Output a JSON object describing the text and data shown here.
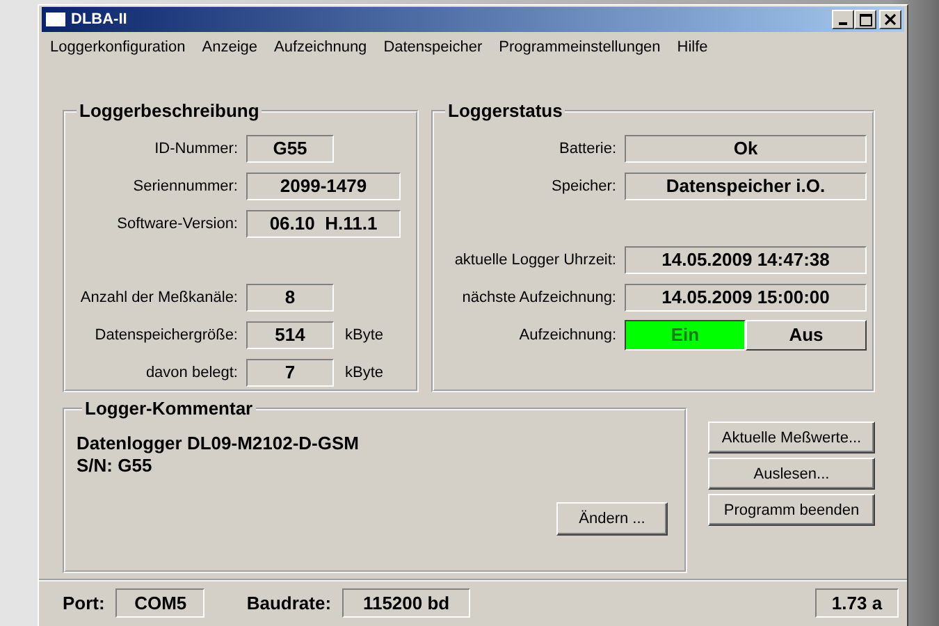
{
  "window": {
    "title": "DLBA-II"
  },
  "menu": [
    "Loggerkonfiguration",
    "Anzeige",
    "Aufzeichnung",
    "Datenspeicher",
    "Programmeinstellungen",
    "Hilfe"
  ],
  "description": {
    "title": "Loggerbeschreibung",
    "groups": [
      [
        {
          "label": "ID-Nummer:",
          "value": "G55",
          "kind": "short"
        },
        {
          "label": "Seriennummer:",
          "value": "2099-1479",
          "kind": "wide"
        },
        {
          "label": "Software-Version:",
          "value": "06.10  H.11.1",
          "kind": "wide"
        }
      ],
      [
        {
          "label": "Anzahl der Meßkanäle:",
          "value": "8",
          "kind": "short"
        },
        {
          "label": "Datenspeichergröße:",
          "value": "514",
          "kind": "short",
          "unit": "kByte"
        },
        {
          "label": "davon belegt:",
          "value": "7",
          "kind": "short",
          "unit": "kByte"
        }
      ]
    ]
  },
  "status": {
    "title": "Loggerstatus",
    "groups": [
      [
        {
          "label": "Batterie:",
          "value": "Ok"
        },
        {
          "label": "Speicher:",
          "value": "Datenspeicher i.O."
        }
      ],
      [
        {
          "label": "aktuelle Logger Uhrzeit:",
          "value": "14.05.2009 14:47:38"
        },
        {
          "label": "nächste Aufzeichnung:",
          "value": "14.05.2009 15:00:00"
        }
      ]
    ],
    "recording": {
      "label": "Aufzeichnung:",
      "options": [
        {
          "label": "Ein",
          "selected": true
        },
        {
          "label": "Aus",
          "selected": false
        }
      ]
    }
  },
  "comment": {
    "title": "Logger-Kommentar",
    "lines": [
      "Datenlogger DL09-M2102-D-GSM",
      "S/N: G55"
    ],
    "button": "Ändern ..."
  },
  "buttons": [
    "Aktuelle Meßwerte...",
    "Auslesen...",
    "Programm beenden"
  ],
  "status_bar": {
    "port_label": "Port:",
    "port": "COM5",
    "baud_label": "Baudrate:",
    "baud": "115200 bd",
    "version": "1.73 a"
  }
}
